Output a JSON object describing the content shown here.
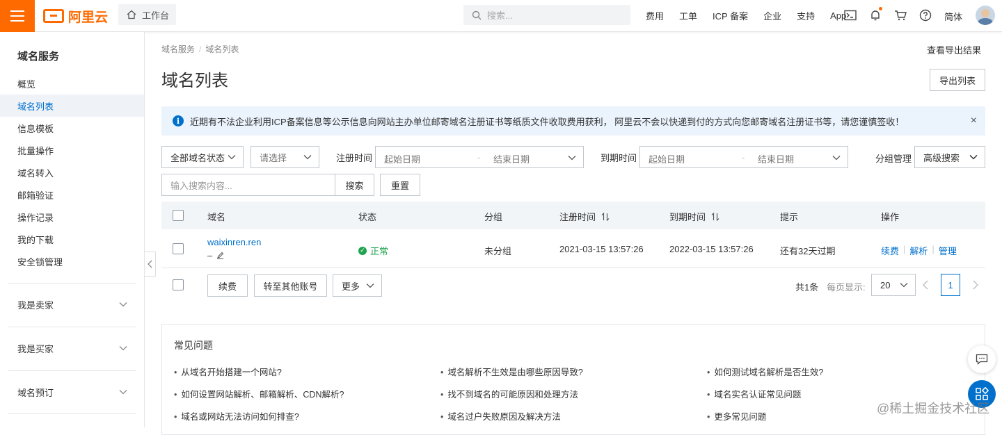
{
  "header": {
    "brand": "阿里云",
    "workbench": "工作台",
    "search_placeholder": "搜索...",
    "links": [
      "费用",
      "工单",
      "ICP 备案",
      "企业",
      "支持",
      "App"
    ],
    "lang": "简体",
    "accent": "#ff6a00"
  },
  "sidebar": {
    "title": "域名服务",
    "items": [
      {
        "label": "概览",
        "active": false
      },
      {
        "label": "域名列表",
        "active": true
      },
      {
        "label": "信息模板",
        "active": false
      },
      {
        "label": "批量操作",
        "active": false
      },
      {
        "label": "域名转入",
        "active": false
      },
      {
        "label": "邮箱验证",
        "active": false
      },
      {
        "label": "操作记录",
        "active": false
      },
      {
        "label": "我的下载",
        "active": false
      },
      {
        "label": "安全锁管理",
        "active": false
      }
    ],
    "groups": [
      "我是卖家",
      "我是买家",
      "域名预订"
    ]
  },
  "breadcrumb": {
    "root": "域名服务",
    "current": "域名列表"
  },
  "export_results_link": "查看导出结果",
  "page_title": "域名列表",
  "export_button": "导出列表",
  "notice": "近期有不法企业利用ICP备案信息等公示信息向网站主办单位邮寄域名注册证书等纸质文件收取费用获利， 阿里云不会以快递到付的方式向您邮寄域名注册证书等，请您谨慎签收！",
  "filters": {
    "status_select": "全部域名状态",
    "please_select": "请选择",
    "reg_time_label": "注册时间",
    "exp_time_label": "到期时间",
    "start_date": "起始日期",
    "range_dash": "-",
    "end_date": "结束日期",
    "group_mgmt": "分组管理",
    "advanced_search": "高级搜索",
    "search_placeholder": "输入搜索内容...",
    "search_button": "搜索",
    "reset_button": "重置"
  },
  "table": {
    "headers": [
      "域名",
      "状态",
      "分组",
      "注册时间",
      "到期时间",
      "提示",
      "操作"
    ],
    "rows": [
      {
        "domain": "waixinren.ren",
        "sub": "–",
        "status": "正常",
        "group": "未分组",
        "reg_time": "2021-03-15 13:57:26",
        "exp_time": "2022-03-15 13:57:26",
        "tip": "还有32天过期",
        "actions": [
          "续费",
          "解析",
          "管理"
        ],
        "action_sep": "|"
      }
    ]
  },
  "bulk": {
    "renew": "续费",
    "transfer": "转至其他账号",
    "more": "更多"
  },
  "pager": {
    "total": "共1条",
    "per_page_label": "每页显示:",
    "per_page": "20",
    "current_page": "1"
  },
  "faq": {
    "title": "常见问题",
    "items": [
      "从域名开始搭建一个网站?",
      "域名解析不生效是由哪些原因导致?",
      "如何测试域名解析是否生效?",
      "如何设置网站解析、邮箱解析、CDN解析?",
      "找不到域名的可能原因和处理方法",
      "域名实名认证常见问题",
      "域名或网站无法访问如何排查?",
      "域名过户失败原因及解决方法",
      "更多常见问题"
    ]
  },
  "watermark": "@稀土掘金技术社区"
}
